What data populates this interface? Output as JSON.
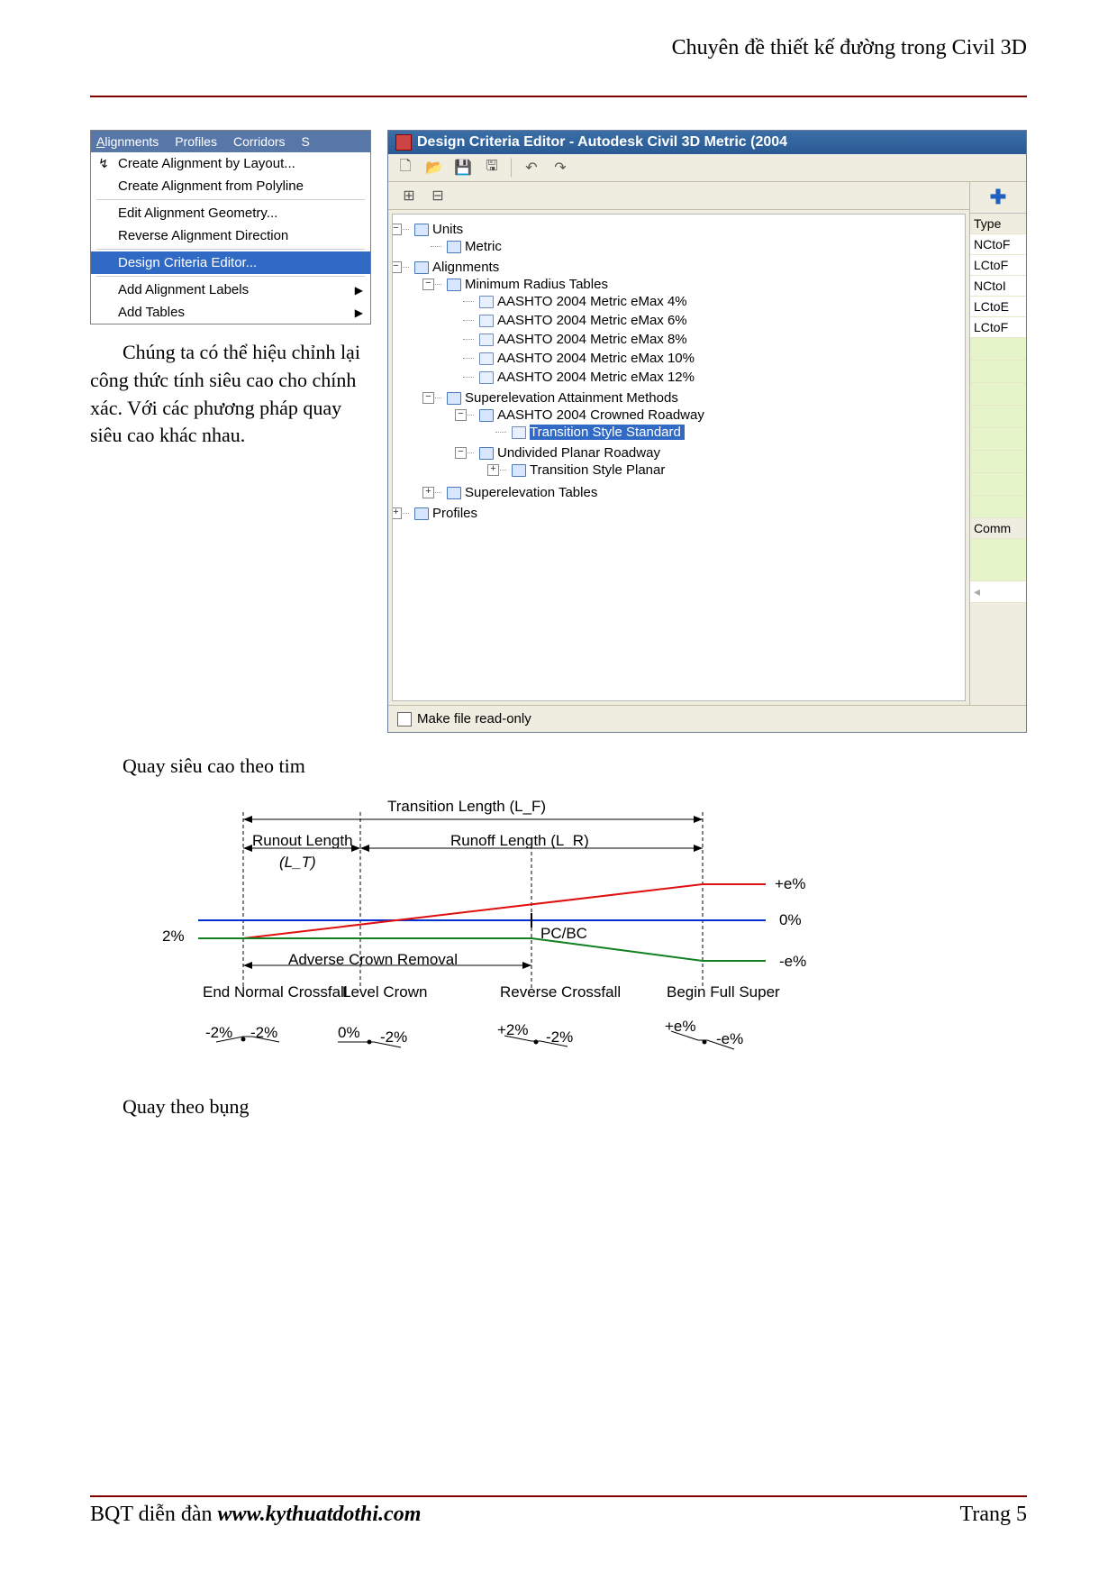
{
  "header": {
    "right": "Chuyên đề thiết kế đường trong Civil 3D"
  },
  "footer": {
    "left_prefix": "BQT diễn đàn ",
    "left_url": "www.kythuatdothi.com",
    "right": "Trang 5"
  },
  "menu": {
    "bar": [
      "Alignments",
      "Profiles",
      "Corridors",
      "S"
    ],
    "items": [
      {
        "label": "Create Alignment by Layout...",
        "icon": "↳",
        "sep": false
      },
      {
        "label": "Create Alignment from Polyline",
        "sep": true
      },
      {
        "label": "Edit Alignment Geometry..."
      },
      {
        "label": "Reverse Alignment Direction",
        "sep": true
      },
      {
        "label": "Design Criteria Editor...",
        "selected": true,
        "sep": true
      },
      {
        "label": "Add Alignment Labels",
        "submenu": true
      },
      {
        "label": "Add Tables",
        "submenu": true
      }
    ]
  },
  "paragraph1": "Chúng ta có thể hiệu chỉnh lại công thức tính siêu cao cho chính xác. Với các phương pháp quay siêu cao khác nhau.",
  "editor": {
    "title": "Design Criteria Editor - Autodesk Civil 3D Metric (2004",
    "toolbar1_icons": [
      "new-icon",
      "open-icon",
      "save-icon",
      "saveall-icon",
      "undo-icon",
      "redo-icon"
    ],
    "toolbar2_icons": [
      "expand-icon",
      "collapse-icon"
    ],
    "tree": {
      "units": {
        "label": "Units",
        "children": [
          "Metric"
        ]
      },
      "alignments": {
        "label": "Alignments",
        "min_radius": {
          "label": "Minimum Radius Tables",
          "rows": [
            "AASHTO 2004 Metric eMax 4%",
            "AASHTO 2004 Metric eMax 6%",
            "AASHTO 2004 Metric eMax 8%",
            "AASHTO 2004 Metric eMax 10%",
            "AASHTO 2004 Metric eMax 12%"
          ]
        },
        "methods": {
          "label": "Superelevation Attainment Methods",
          "crowned": {
            "label": "AASHTO 2004 Crowned Roadway",
            "child": "Transition Style Standard"
          },
          "undivided": {
            "label": "Undivided Planar Roadway",
            "child": "Transition Style Planar"
          }
        },
        "tables": "Superelevation Tables"
      },
      "profiles": "Profiles"
    },
    "side": {
      "header": "Type",
      "rows": [
        "NCtoF",
        "LCtoF",
        "NCtoI",
        "LCtoE",
        "LCtoF"
      ],
      "comm": "Comm"
    },
    "checkbox": "Make file read-only"
  },
  "text_quay_tim": "Quay siêu cao theo tim",
  "text_quay_bung": "Quay theo bụng",
  "chart_data": {
    "type": "diagram",
    "title": "Transition Length (L_F)",
    "top_labels": {
      "runout": "Runout Length",
      "runout_sym": "(L_T)",
      "runoff": "Runoff Length (L_R)"
    },
    "y_left": "2%",
    "y_right": [
      "+e%",
      "0%",
      "-e%"
    ],
    "acr_label": "Adverse Crown Removal",
    "pcbc": "PC/BC",
    "stations": [
      {
        "name": "End Normal Crossfall",
        "left": "-2%",
        "right": "-2%"
      },
      {
        "name": "Level Crown",
        "left": "0%",
        "right": "-2%"
      },
      {
        "name": "Reverse Crossfall",
        "left": "+2%",
        "right": "-2%"
      },
      {
        "name": "Begin Full Super",
        "left": "+e%",
        "right": "-e%"
      }
    ],
    "series": [
      {
        "name": "blue",
        "color": "#0030d0",
        "desc": "0% horizontal"
      },
      {
        "name": "red",
        "color": "#e01010",
        "desc": "rises from -2% to +e%"
      },
      {
        "name": "green",
        "color": "#108020",
        "desc": "flat -2% then drops to -e%"
      }
    ]
  }
}
